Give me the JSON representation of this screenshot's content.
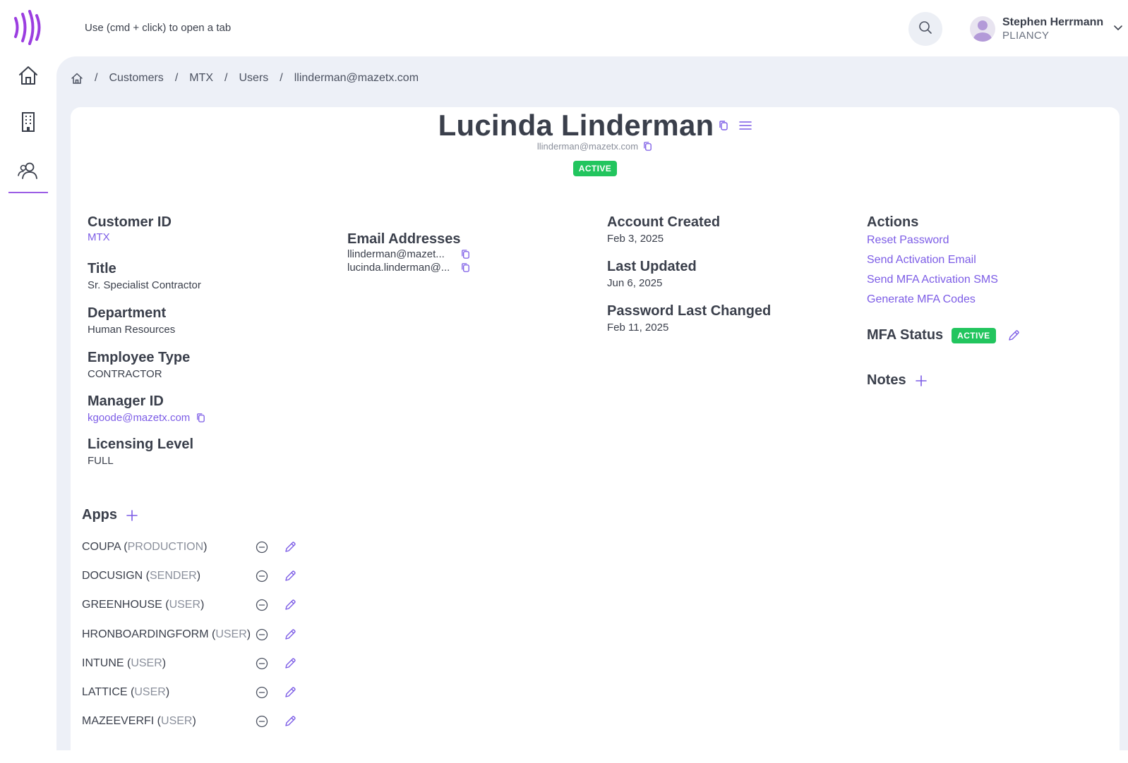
{
  "header": {
    "hint": "Use (cmd + click) to open a tab",
    "search_icon": "search-icon",
    "user": {
      "name": "Stephen Herrmann",
      "org": "PLIANCY"
    }
  },
  "sidebar": {
    "items": [
      {
        "icon": "home-icon",
        "label": "Home"
      },
      {
        "icon": "building-icon",
        "label": "Customers"
      },
      {
        "icon": "users-icon",
        "label": "Users",
        "active": true
      }
    ]
  },
  "breadcrumb": {
    "items": [
      "Customers",
      "MTX",
      "Users",
      "llinderman@mazetx.com"
    ],
    "separator": "/"
  },
  "profile": {
    "name": "Lucinda Linderman",
    "email": "llinderman@mazetx.com",
    "status": "ACTIVE"
  },
  "details": {
    "customer_id_label": "Customer ID",
    "customer_id": "MTX",
    "title_label": "Title",
    "title": "Sr. Specialist Contractor",
    "department_label": "Department",
    "department": "Human Resources",
    "employee_type_label": "Employee Type",
    "employee_type": "CONTRACTOR",
    "manager_id_label": "Manager ID",
    "manager_id": "kgoode@mazetx.com",
    "licensing_level_label": "Licensing Level",
    "licensing_level": "FULL"
  },
  "emails": {
    "label": "Email Addresses",
    "items": [
      "llinderman@mazet...",
      "lucinda.linderman@..."
    ]
  },
  "dates": {
    "created_label": "Account Created",
    "created": "Feb 3, 2025",
    "updated_label": "Last Updated",
    "updated": "Jun 6, 2025",
    "pw_label": "Password Last Changed",
    "pw": "Feb 11, 2025"
  },
  "actions": {
    "label": "Actions",
    "items": [
      "Reset Password",
      "Send Activation Email",
      "Send MFA Activation SMS",
      "Generate MFA Codes"
    ],
    "mfa_label": "MFA Status",
    "mfa_status": "ACTIVE",
    "notes_label": "Notes"
  },
  "apps": {
    "label": "Apps",
    "items": [
      {
        "name": "COUPA",
        "role": "PRODUCTION"
      },
      {
        "name": "DOCUSIGN",
        "role": "SENDER"
      },
      {
        "name": "GREENHOUSE",
        "role": "USER"
      },
      {
        "name": "HRONBOARDINGFORM",
        "role": "USER"
      },
      {
        "name": "INTUNE",
        "role": "USER"
      },
      {
        "name": "LATTICE",
        "role": "USER"
      },
      {
        "name": "MAZEEVERFI",
        "role": "USER"
      }
    ]
  },
  "colors": {
    "accent": "#7c5ce6",
    "logo": "#9b3de0",
    "active_badge": "#22c55e",
    "page_bg": "#edf0f7"
  }
}
